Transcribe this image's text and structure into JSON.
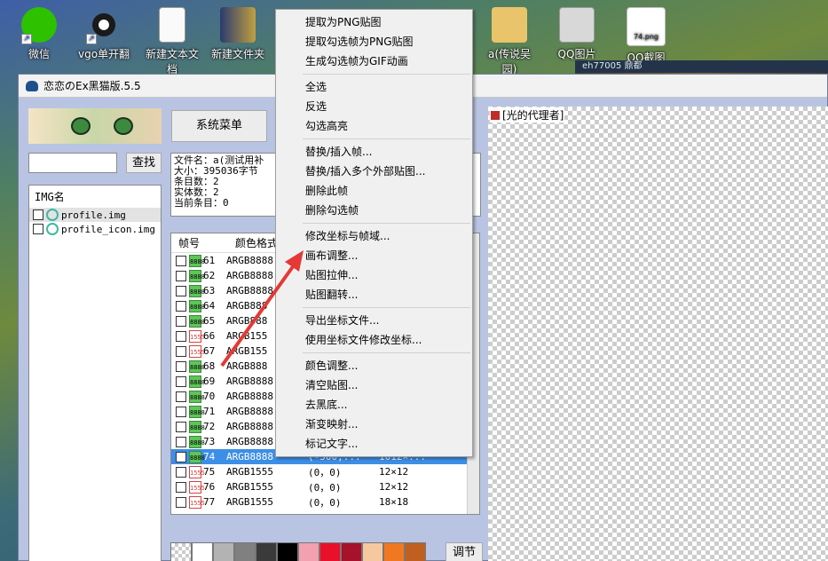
{
  "desktop": {
    "icons": [
      "微信",
      "vgo单开翻",
      "新建文本文档",
      "新建文件夹",
      "a(传说吴园)",
      "QQ图片",
      "QQ截图"
    ],
    "file_label": "74.png",
    "tray_text": "eh77005 鼎都"
  },
  "window": {
    "title": "恋恋のEx黑猫版.5.5",
    "system_menu_label": "系统菜单",
    "search_button": "查找",
    "img_list": {
      "header": "IMG名",
      "items": [
        "profile.img",
        "profile_icon.img"
      ]
    },
    "info": {
      "lines": [
        "文件名：a(测试用补",
        "大小：395036字节",
        "条目数：2",
        "实体数：2",
        "当前条目：0"
      ]
    },
    "frame_table": {
      "headers": [
        "帧号",
        "颜色格式"
      ],
      "rows": [
        {
          "num": "61",
          "fmt": "ARGB8888",
          "icon": "8888",
          "pos": "",
          "size": ""
        },
        {
          "num": "62",
          "fmt": "ARGB8888",
          "icon": "8888",
          "pos": "",
          "size": ""
        },
        {
          "num": "63",
          "fmt": "ARGB8888",
          "icon": "8888",
          "pos": "",
          "size": ""
        },
        {
          "num": "64",
          "fmt": "ARGB888",
          "icon": "8888",
          "pos": "",
          "size": ""
        },
        {
          "num": "65",
          "fmt": "ARGB888",
          "icon": "8888",
          "pos": "",
          "size": ""
        },
        {
          "num": "66",
          "fmt": "ARGB155",
          "icon": "1555",
          "pos": "",
          "size": ""
        },
        {
          "num": "67",
          "fmt": "ARGB155",
          "icon": "1555",
          "pos": "",
          "size": ""
        },
        {
          "num": "68",
          "fmt": "ARGB888",
          "icon": "8888",
          "pos": "",
          "size": ""
        },
        {
          "num": "69",
          "fmt": "ARGB8888",
          "icon": "8888",
          "pos": "",
          "size": ""
        },
        {
          "num": "70",
          "fmt": "ARGB8888",
          "icon": "8888",
          "pos": "",
          "size": ""
        },
        {
          "num": "71",
          "fmt": "ARGB8888",
          "icon": "8888",
          "pos": "",
          "size": ""
        },
        {
          "num": "72",
          "fmt": "ARGB8888",
          "icon": "8888",
          "pos": "",
          "size": ""
        },
        {
          "num": "73",
          "fmt": "ARGB8888",
          "icon": "8888",
          "pos": "",
          "size": ""
        },
        {
          "num": "74",
          "fmt": "ARGB8888",
          "icon": "8888",
          "pos": "(-500,...",
          "size": "1012×...",
          "selected": true
        },
        {
          "num": "75",
          "fmt": "ARGB1555",
          "icon": "1555",
          "pos": "(0，0)",
          "size": "12×12"
        },
        {
          "num": "76",
          "fmt": "ARGB1555",
          "icon": "1555",
          "pos": "(0，0)",
          "size": "12×12"
        },
        {
          "num": "77",
          "fmt": "ARGB1555",
          "icon": "1555",
          "pos": "(0，0)",
          "size": "18×18"
        }
      ]
    },
    "adjust_button": "调节",
    "canvas_label": "[光的代理者]",
    "swatch_colors": [
      "#ffffff",
      "#b3b3b3",
      "#808080",
      "#3a3a3a",
      "#000000",
      "#f3a0b0",
      "#e8102a",
      "#a5122a",
      "#f6c8a0",
      "#f07820",
      "#c06020"
    ]
  },
  "context_menu": {
    "groups": [
      [
        "提取为PNG贴图",
        "提取勾选帧为PNG贴图",
        "生成勾选帧为GIF动画"
      ],
      [
        "全选",
        "反选",
        "勾选高亮"
      ],
      [
        "替换/插入帧...",
        "替换/插入多个外部贴图...",
        "删除此帧",
        "删除勾选帧"
      ],
      [
        "修改坐标与帧域...",
        "画布调整...",
        "贴图拉伸...",
        "贴图翻转..."
      ],
      [
        "导出坐标文件...",
        "使用坐标文件修改坐标..."
      ],
      [
        "颜色调整...",
        "清空贴图...",
        "去黑底...",
        "渐变映射...",
        "标记文字..."
      ]
    ]
  },
  "annotation": {
    "arrow_color": "#e53935"
  }
}
